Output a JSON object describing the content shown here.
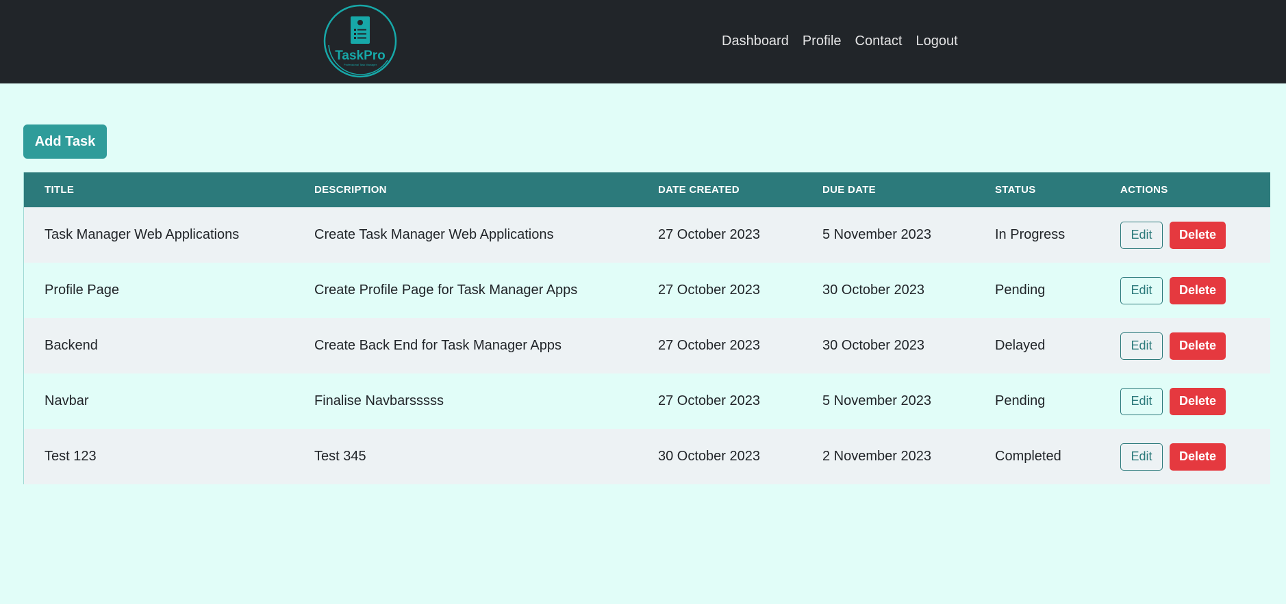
{
  "brand": {
    "name": "TaskPro",
    "tagline": "Professional Task Manager",
    "logo_icon": "clipboard-checklist-icon",
    "accent_color": "#17a8a8"
  },
  "nav": {
    "items": [
      {
        "label": "Dashboard"
      },
      {
        "label": "Profile"
      },
      {
        "label": "Contact"
      },
      {
        "label": "Logout"
      }
    ]
  },
  "toolbar": {
    "add_task_label": "Add Task"
  },
  "table": {
    "headers": [
      "TITLE",
      "DESCRIPTION",
      "DATE CREATED",
      "DUE DATE",
      "STATUS",
      "ACTIONS"
    ],
    "rows": [
      {
        "title": "Task Manager Web Applications",
        "description": "Create Task Manager Web Applications",
        "date_created": "27 October 2023",
        "due_date": "5 November 2023",
        "status": "In Progress",
        "edit_label": "Edit",
        "delete_label": "Delete"
      },
      {
        "title": "Profile Page",
        "description": "Create Profile Page for Task Manager Apps",
        "date_created": "27 October 2023",
        "due_date": "30 October 2023",
        "status": "Pending",
        "edit_label": "Edit",
        "delete_label": "Delete"
      },
      {
        "title": "Backend",
        "description": "Create Back End for Task Manager Apps",
        "date_created": "27 October 2023",
        "due_date": "30 October 2023",
        "status": "Delayed",
        "edit_label": "Edit",
        "delete_label": "Delete"
      },
      {
        "title": "Navbar",
        "description": "Finalise Navbarsssss",
        "date_created": "27 October 2023",
        "due_date": "5 November 2023",
        "status": "Pending",
        "edit_label": "Edit",
        "delete_label": "Delete"
      },
      {
        "title": "Test 123",
        "description": "Test 345",
        "date_created": "30 October 2023",
        "due_date": "2 November 2023",
        "status": "Completed",
        "edit_label": "Edit",
        "delete_label": "Delete"
      }
    ]
  },
  "colors": {
    "navbar_bg": "#212529",
    "page_bg": "#e1fdf8",
    "table_header_bg": "#2c7a7b",
    "add_button_bg": "#2f9c9a",
    "delete_button_bg": "#e5393f"
  }
}
